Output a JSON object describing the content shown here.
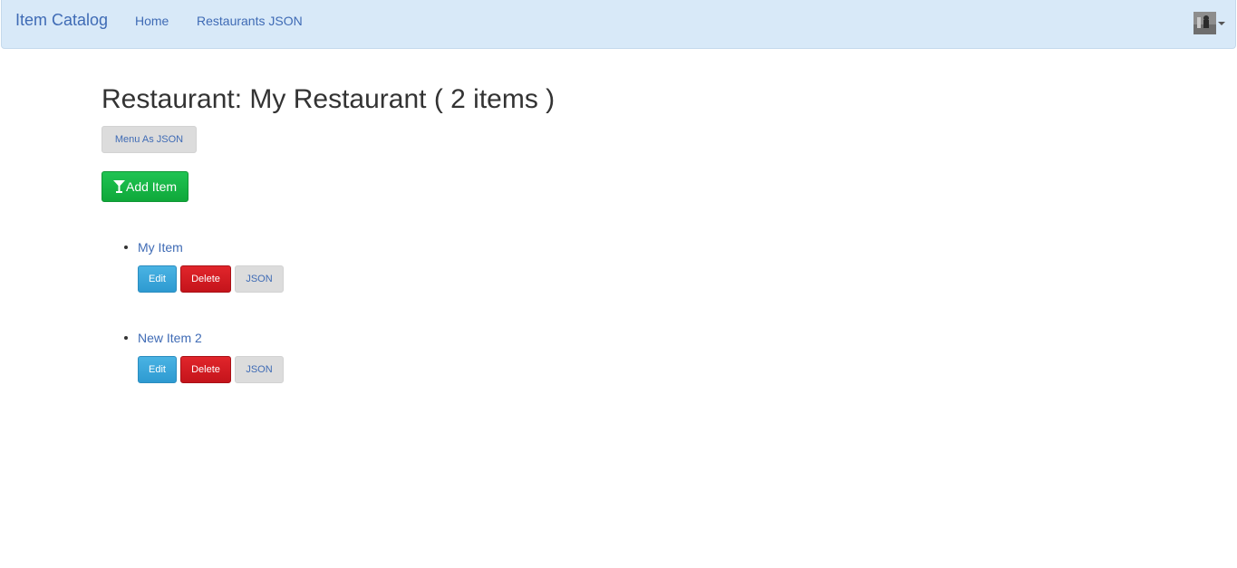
{
  "navbar": {
    "brand": "Item Catalog",
    "links": [
      {
        "label": "Home"
      },
      {
        "label": "Restaurants JSON"
      }
    ]
  },
  "page": {
    "title": "Restaurant: My Restaurant ( 2 items )",
    "menu_json_label": "Menu As JSON",
    "add_item_label": "Add Item",
    "add_item_icon": "glass-icon"
  },
  "items": [
    {
      "name": "My Item",
      "edit_label": "Edit",
      "delete_label": "Delete",
      "json_label": "JSON"
    },
    {
      "name": "New Item 2",
      "edit_label": "Edit",
      "delete_label": "Delete",
      "json_label": "JSON"
    }
  ],
  "colors": {
    "navbar_bg": "#d8e9f8",
    "link": "#3f6bb5",
    "success": "#13b344",
    "info": "#38a6da",
    "danger": "#d21c22",
    "default_btn": "#dcdcdc"
  }
}
